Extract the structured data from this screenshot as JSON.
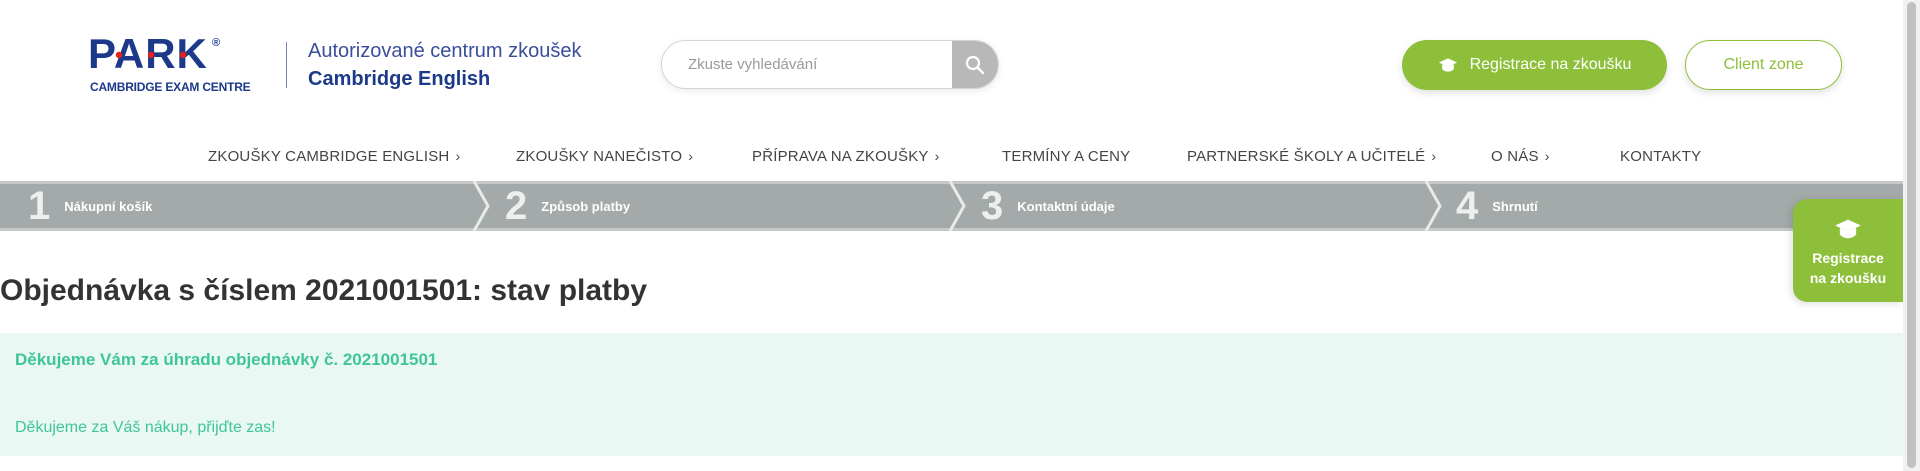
{
  "header": {
    "logo_text": "PARK",
    "logo_reg": "®",
    "logo_sub": "CAMBRIDGE EXAM CENTRE",
    "tagline_1": "Autorizované centrum zkoušek",
    "tagline_2": "Cambridge English",
    "search": {
      "placeholder": "Zkuste vyhledávání"
    },
    "register_button": "Registrace na zkoušku",
    "client_zone_button": "Client zone"
  },
  "nav": {
    "items": [
      {
        "label": "ZKOUŠKY CAMBRIDGE ENGLISH",
        "has_submenu": true
      },
      {
        "label": "ZKOUŠKY NANEČISTO",
        "has_submenu": true
      },
      {
        "label": "PŘÍPRAVA NA ZKOUŠKY",
        "has_submenu": true
      },
      {
        "label": "TERMÍNY A CENY",
        "has_submenu": false
      },
      {
        "label": "PARTNERSKÉ ŠKOLY A UČITELÉ",
        "has_submenu": true
      },
      {
        "label": "O NÁS",
        "has_submenu": true
      },
      {
        "label": "KONTAKTY",
        "has_submenu": false
      }
    ],
    "chevron": "›"
  },
  "steps": [
    {
      "number": "1",
      "label": "Nákupní košík"
    },
    {
      "number": "2",
      "label": "Způsob platby"
    },
    {
      "number": "3",
      "label": "Kontaktní údaje"
    },
    {
      "number": "4",
      "label": "Shrnutí"
    }
  ],
  "main": {
    "title": "Objednávka s číslem 2021001501: stav platby",
    "success_title": "Děkujeme Vám za úhradu objednávky č. 2021001501",
    "success_text": "Děkujeme za Váš nákup, přijďte zas!"
  },
  "floating_tab": {
    "line_1": "Registrace",
    "line_2": "na zkoušku"
  },
  "colors": {
    "brand_blue": "#1d3a8a",
    "brand_red": "#e2231a",
    "accent_green": "#8dbf3a",
    "success_green": "#3fc59a",
    "success_bg": "#eaf8f3",
    "steps_bg": "#a3aaa9"
  },
  "icons": {
    "search": "search-icon",
    "graduation_cap": "graduation-cap-icon"
  }
}
